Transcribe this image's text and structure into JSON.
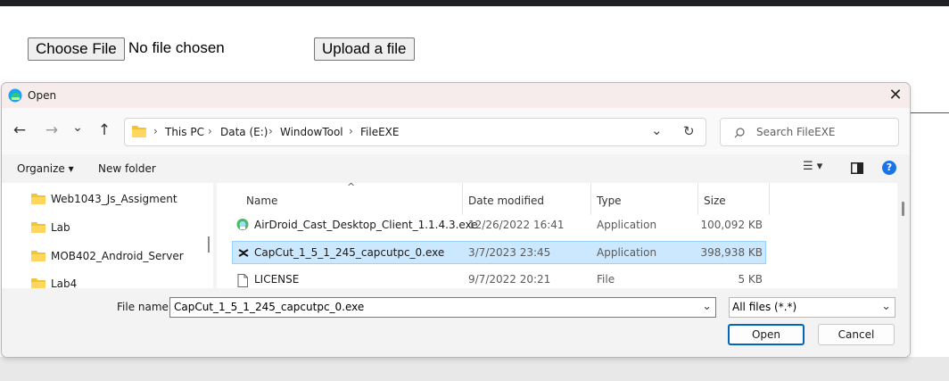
{
  "page": {
    "choose_file_label": "Choose File",
    "no_file_text": "No file chosen",
    "upload_label": "Upload a file"
  },
  "dialog": {
    "title": "Open",
    "close_glyph": "✕",
    "nav": {
      "back": "←",
      "forward": "→",
      "recent": "⌄",
      "up": "↑"
    },
    "breadcrumb": [
      "This PC",
      "Data (E:)",
      "WindowTool",
      "FileEXE"
    ],
    "breadcrumb_sep": "›",
    "address_dropdown": "⌄",
    "refresh_glyph": "↻",
    "search_placeholder": "Search FileEXE",
    "organize_label": "Organize ▾",
    "new_folder_label": "New folder",
    "view_glyph": "☰ ▾",
    "help_glyph": "?",
    "nav_items": [
      {
        "label": "Web1043_Js_Assigment"
      },
      {
        "label": "Lab"
      },
      {
        "label": "MOB402_Android_Server"
      },
      {
        "label": "Lab4"
      }
    ],
    "columns": {
      "name": "Name",
      "date": "Date modified",
      "type": "Type",
      "size": "Size"
    },
    "sort_indicator": "^",
    "files": [
      {
        "name": "AirDroid_Cast_Desktop_Client_1.1.4.3.exe",
        "date": "12/26/2022 16:41",
        "type": "Application",
        "size": "100,092 KB",
        "icon": "airdroid-icon"
      },
      {
        "name": "CapCut_1_5_1_245_capcutpc_0.exe",
        "date": "3/7/2023 23:45",
        "type": "Application",
        "size": "398,938 KB",
        "icon": "capcut-icon",
        "selected": true
      },
      {
        "name": "LICENSE",
        "date": "9/7/2022 20:21",
        "type": "File",
        "size": "5 KB",
        "icon": "document-icon"
      }
    ],
    "file_name_label": "File name:",
    "file_name_value": "CapCut_1_5_1_245_capcutpc_0.exe",
    "filter_value": "All files (*.*)",
    "open_label": "Open",
    "cancel_label": "Cancel"
  },
  "colors": {
    "selection": "#cce8ff",
    "accent": "#0067c0",
    "folder": "#f3c237"
  }
}
